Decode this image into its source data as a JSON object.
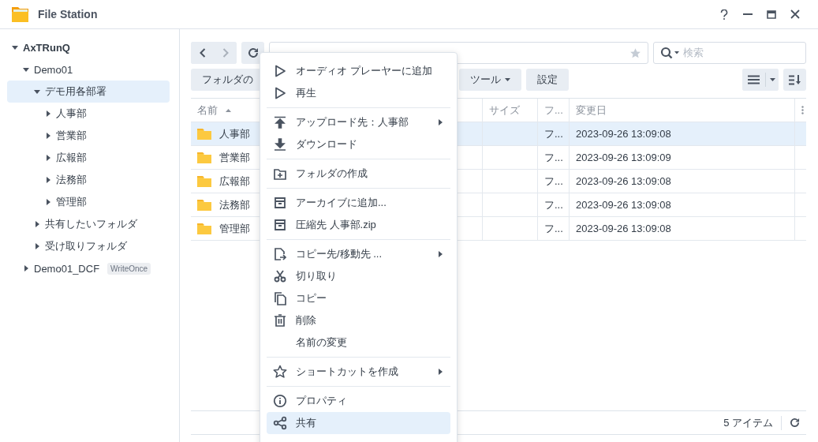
{
  "window": {
    "title": "File Station"
  },
  "tree": [
    {
      "label": "AxTRunQ",
      "expanded": true,
      "selected": false,
      "children": [
        {
          "label": "Demo01",
          "expanded": true,
          "selected": false,
          "children": [
            {
              "label": "デモ用各部署",
              "expanded": true,
              "selected": true,
              "children": [
                {
                  "label": "人事部",
                  "expanded": false,
                  "selected": false
                },
                {
                  "label": "営業部",
                  "expanded": false,
                  "selected": false
                },
                {
                  "label": "広報部",
                  "expanded": false,
                  "selected": false
                },
                {
                  "label": "法務部",
                  "expanded": false,
                  "selected": false
                },
                {
                  "label": "管理部",
                  "expanded": false,
                  "selected": false
                }
              ]
            },
            {
              "label": "共有したいフォルダ",
              "expanded": false,
              "selected": false
            },
            {
              "label": "受け取りフォルダ",
              "expanded": false,
              "selected": false
            }
          ]
        },
        {
          "label": "Demo01_DCF",
          "expanded": false,
          "selected": false,
          "badge": "WriteOnce"
        }
      ]
    }
  ],
  "search": {
    "placeholder": "検索"
  },
  "toolbar": [
    {
      "label": "フォルダの",
      "dropdown": false
    },
    {
      "label": "ツール",
      "dropdown": true
    },
    {
      "label": "設定",
      "dropdown": false
    }
  ],
  "table": {
    "columns": [
      {
        "label": "名前",
        "sorted": true
      },
      {
        "label": "サイズ",
        "sorted": false
      },
      {
        "label": "フ...",
        "sorted": false
      },
      {
        "label": "変更日",
        "sorted": false
      }
    ],
    "rows": [
      {
        "name": "人事部",
        "type": "フ...",
        "modified": "2023-09-26 13:09:08",
        "selected": true
      },
      {
        "name": "営業部",
        "type": "フ...",
        "modified": "2023-09-26 13:09:09",
        "selected": false
      },
      {
        "name": "広報部",
        "type": "フ...",
        "modified": "2023-09-26 13:09:08",
        "selected": false
      },
      {
        "name": "法務部",
        "type": "フ...",
        "modified": "2023-09-26 13:09:08",
        "selected": false
      },
      {
        "name": "管理部",
        "type": "フ...",
        "modified": "2023-09-26 13:09:08",
        "selected": false
      }
    ]
  },
  "status_bar": {
    "count": "5 アイテム"
  },
  "context_menu": {
    "groups": [
      [
        {
          "label": "オーディオ プレーヤーに追加",
          "submenu": false,
          "selected": false
        },
        {
          "label": "再生",
          "submenu": false,
          "selected": false
        }
      ],
      [
        {
          "label": "アップロード先：人事部",
          "submenu": true,
          "selected": false
        },
        {
          "label": "ダウンロード",
          "submenu": false,
          "selected": false
        }
      ],
      [
        {
          "label": "フォルダの作成",
          "submenu": false,
          "selected": false
        }
      ],
      [
        {
          "label": "アーカイブに追加...",
          "submenu": false,
          "selected": false
        },
        {
          "label": "圧縮先 人事部.zip",
          "submenu": false,
          "selected": false
        }
      ],
      [
        {
          "label": "コピー先/移動先 ...",
          "submenu": true,
          "selected": false
        },
        {
          "label": "切り取り",
          "submenu": false,
          "selected": false
        },
        {
          "label": "コピー",
          "submenu": false,
          "selected": false
        },
        {
          "label": "削除",
          "submenu": false,
          "selected": false
        },
        {
          "label": "名前の変更",
          "submenu": false,
          "selected": false
        }
      ],
      [
        {
          "label": "ショートカットを作成",
          "submenu": true,
          "selected": false
        }
      ],
      [
        {
          "label": "プロパティ",
          "submenu": false,
          "selected": false
        },
        {
          "label": "共有",
          "submenu": false,
          "selected": true
        }
      ]
    ]
  }
}
